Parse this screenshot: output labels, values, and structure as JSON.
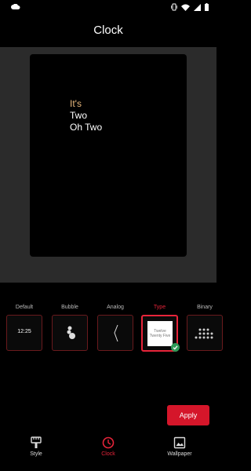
{
  "screen": {
    "title": "Clock"
  },
  "preview": {
    "line1": "It's",
    "line2": "Two",
    "line3": "Oh Two"
  },
  "clock_options": [
    {
      "label": "Default",
      "preview_text": "12:25",
      "icon": "digital-clock-icon"
    },
    {
      "label": "Bubble",
      "icon": "bubble-clock-icon"
    },
    {
      "label": "Analog",
      "icon": "analog-clock-icon"
    },
    {
      "label": "Type",
      "preview_text": "Twelve Twenty Five",
      "icon": "type-clock-icon",
      "selected": true
    },
    {
      "label": "Binary",
      "icon": "binary-clock-icon"
    }
  ],
  "apply_label": "Apply",
  "bottom_nav": [
    {
      "label": "Style",
      "icon": "brush-icon"
    },
    {
      "label": "Clock",
      "icon": "clock-icon",
      "active": true
    },
    {
      "label": "Wallpaper",
      "icon": "wallpaper-icon"
    }
  ],
  "colors": {
    "accent": "#e8243a",
    "preview_highlight": "#e8b87c",
    "preview_background": "#2b2b2b"
  }
}
